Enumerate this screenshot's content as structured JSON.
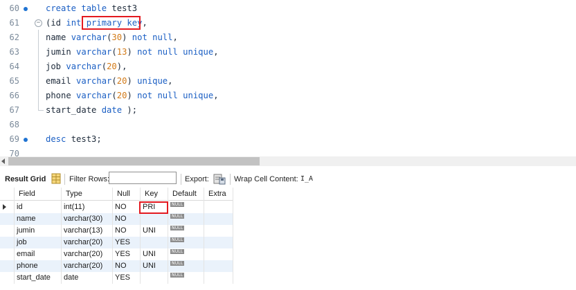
{
  "editor": {
    "lines": [
      {
        "n": "60",
        "tokens": [
          [
            "kw",
            "create table "
          ],
          [
            "plain",
            "test3"
          ]
        ]
      },
      {
        "n": "61",
        "tokens": [
          [
            "plain",
            "(id "
          ],
          [
            "kw",
            "int "
          ],
          [
            "kw",
            "primary key"
          ],
          [
            "plain",
            ","
          ]
        ]
      },
      {
        "n": "62",
        "tokens": [
          [
            "plain",
            "name "
          ],
          [
            "kw",
            "varchar"
          ],
          [
            "plain",
            "("
          ],
          [
            "num",
            "30"
          ],
          [
            "plain",
            ") "
          ],
          [
            "kw",
            "not null"
          ],
          [
            "plain",
            ","
          ]
        ]
      },
      {
        "n": "63",
        "tokens": [
          [
            "plain",
            "jumin "
          ],
          [
            "kw",
            "varchar"
          ],
          [
            "plain",
            "("
          ],
          [
            "num",
            "13"
          ],
          [
            "plain",
            ") "
          ],
          [
            "kw",
            "not null unique"
          ],
          [
            "plain",
            ","
          ]
        ]
      },
      {
        "n": "64",
        "tokens": [
          [
            "plain",
            "job "
          ],
          [
            "kw",
            "varchar"
          ],
          [
            "plain",
            "("
          ],
          [
            "num",
            "20"
          ],
          [
            "plain",
            "),"
          ]
        ]
      },
      {
        "n": "65",
        "tokens": [
          [
            "plain",
            "email "
          ],
          [
            "kw",
            "varchar"
          ],
          [
            "plain",
            "("
          ],
          [
            "num",
            "20"
          ],
          [
            "plain",
            ") "
          ],
          [
            "kw",
            "unique"
          ],
          [
            "plain",
            ","
          ]
        ]
      },
      {
        "n": "66",
        "tokens": [
          [
            "plain",
            "phone "
          ],
          [
            "kw",
            "varchar"
          ],
          [
            "plain",
            "("
          ],
          [
            "num",
            "20"
          ],
          [
            "plain",
            ") "
          ],
          [
            "kw",
            "not null unique"
          ],
          [
            "plain",
            ","
          ]
        ]
      },
      {
        "n": "67",
        "tokens": [
          [
            "plain",
            "start_date "
          ],
          [
            "kw",
            "date "
          ],
          [
            "plain",
            ");"
          ]
        ]
      },
      {
        "n": "68",
        "tokens": []
      },
      {
        "n": "69",
        "tokens": [
          [
            "kw",
            "desc "
          ],
          [
            "plain",
            "test3;"
          ]
        ]
      },
      {
        "n": "70",
        "tokens": []
      }
    ]
  },
  "toolbar": {
    "result_grid_label": "Result Grid",
    "filter_rows_label": "Filter Rows:",
    "filter_value": "",
    "export_label": "Export:",
    "wrap_label": "Wrap Cell Content:",
    "wrap_icon_text": "I̲A"
  },
  "grid": {
    "columns": [
      "Field",
      "Type",
      "Null",
      "Key",
      "Default",
      "Extra"
    ],
    "null_text": "NULL",
    "rows": [
      {
        "field": "id",
        "type": "int(11)",
        "null": "NO",
        "key": "PRI"
      },
      {
        "field": "name",
        "type": "varchar(30)",
        "null": "NO",
        "key": ""
      },
      {
        "field": "jumin",
        "type": "varchar(13)",
        "null": "NO",
        "key": "UNI"
      },
      {
        "field": "job",
        "type": "varchar(20)",
        "null": "YES",
        "key": ""
      },
      {
        "field": "email",
        "type": "varchar(20)",
        "null": "YES",
        "key": "UNI"
      },
      {
        "field": "phone",
        "type": "varchar(20)",
        "null": "NO",
        "key": "UNI"
      },
      {
        "field": "start_date",
        "type": "date",
        "null": "YES",
        "key": ""
      }
    ]
  },
  "colors": {
    "keyword": "#1b5fc4",
    "number": "#d27a18",
    "highlight_box": "#e3191f",
    "alt_row": "#eaf2fb"
  }
}
